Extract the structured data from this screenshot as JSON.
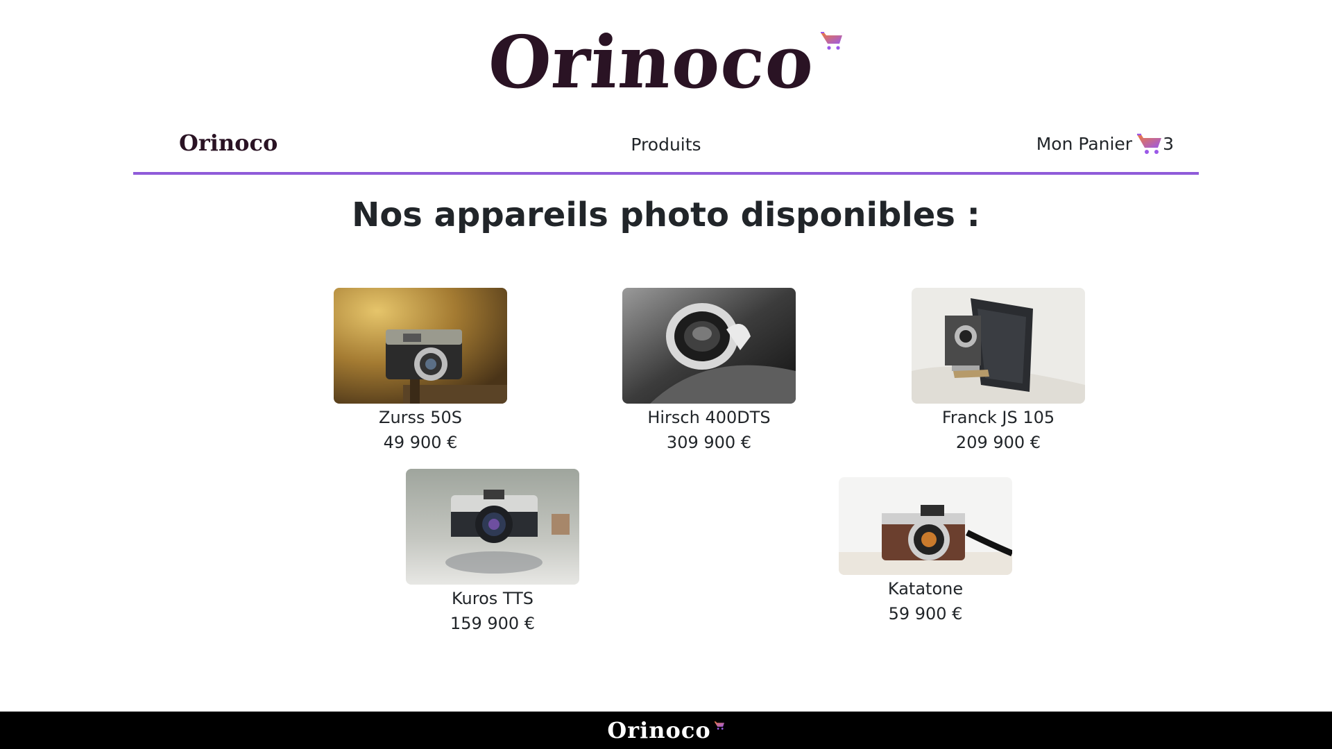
{
  "header": {
    "logo_text": "Orinoco"
  },
  "nav": {
    "brand": "Orinoco",
    "products_label": "Produits",
    "cart_label": "Mon Panier",
    "cart_count": "3"
  },
  "main": {
    "title": "Nos appareils photo disponibles :",
    "products": [
      {
        "name": "Zurss 50S",
        "price": "49 900 €"
      },
      {
        "name": "Hirsch 400DTS",
        "price": "309 900 €"
      },
      {
        "name": "Franck JS 105",
        "price": "209 900 €"
      },
      {
        "name": "Kuros TTS",
        "price": "159 900 €"
      },
      {
        "name": "Katatone",
        "price": "59 900 €"
      }
    ]
  },
  "footer": {
    "logo_text": "Orinoco"
  },
  "colors": {
    "accent": "#8f5bd9",
    "logo": "#2a1324",
    "footer_bg": "#000000",
    "cart_gradient_start": "#f07a3a",
    "cart_gradient_end": "#9b59e8"
  },
  "icons": {
    "cart": "cart-icon"
  }
}
